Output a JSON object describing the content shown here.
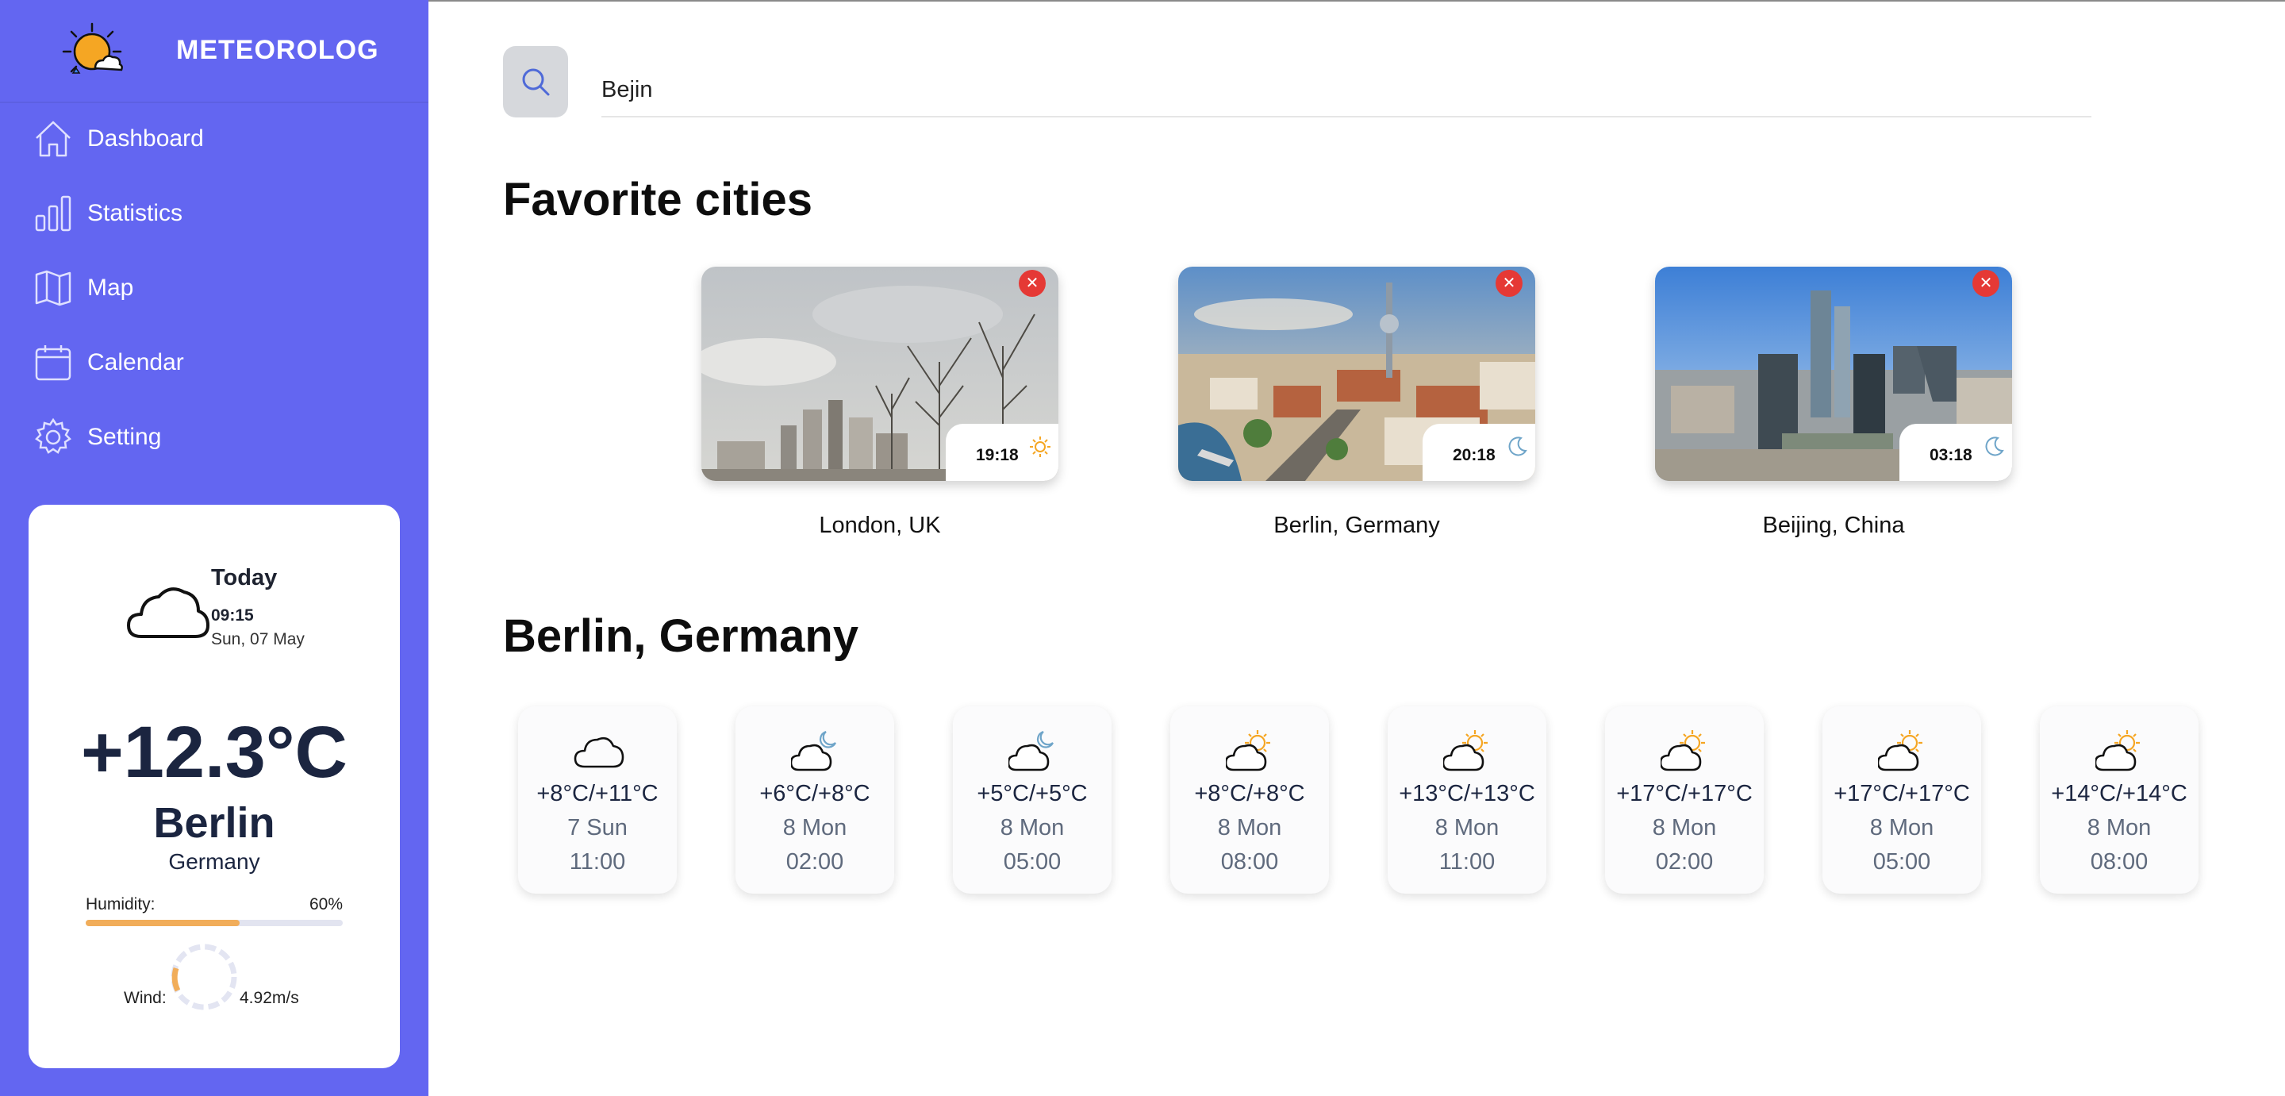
{
  "app": {
    "name": "METEOROLOG"
  },
  "nav": [
    {
      "label": "Dashboard",
      "icon": "home-icon"
    },
    {
      "label": "Statistics",
      "icon": "bar-chart-icon"
    },
    {
      "label": "Map",
      "icon": "map-icon"
    },
    {
      "label": "Calendar",
      "icon": "calendar-icon"
    },
    {
      "label": "Setting",
      "icon": "gear-icon"
    }
  ],
  "today": {
    "label": "Today",
    "time": "09:15",
    "date": "Sun, 07 May",
    "temperature": "+12.3°C",
    "city": "Berlin",
    "country": "Germany",
    "humidity_label": "Humidity:",
    "humidity_value": "60%",
    "humidity_fraction": 0.6,
    "wind_label": "Wind:",
    "wind_value": "4.92m/s"
  },
  "search": {
    "value": "Bejin",
    "icon": "search-icon"
  },
  "favorites": {
    "title": "Favorite cities",
    "cities": [
      {
        "name": "London, UK",
        "time": "19:18",
        "icon": "sun-icon"
      },
      {
        "name": "Berlin, Germany",
        "time": "20:18",
        "icon": "moon-icon"
      },
      {
        "name": "Beijing, China",
        "time": "03:18",
        "icon": "moon-icon"
      }
    ]
  },
  "forecast": {
    "title": "Berlin, Germany",
    "items": [
      {
        "temp": "+8°C/+11°C",
        "day": "7 Sun",
        "hour": "11:00",
        "icon": "cloud-icon"
      },
      {
        "temp": "+6°C/+8°C",
        "day": "8 Mon",
        "hour": "02:00",
        "icon": "cloud-moon-icon"
      },
      {
        "temp": "+5°C/+5°C",
        "day": "8 Mon",
        "hour": "05:00",
        "icon": "cloud-moon-icon"
      },
      {
        "temp": "+8°C/+8°C",
        "day": "8 Mon",
        "hour": "08:00",
        "icon": "sun-cloud-icon"
      },
      {
        "temp": "+13°C/+13°C",
        "day": "8 Mon",
        "hour": "11:00",
        "icon": "sun-cloud-icon"
      },
      {
        "temp": "+17°C/+17°C",
        "day": "8 Mon",
        "hour": "02:00",
        "icon": "sun-cloud-icon"
      },
      {
        "temp": "+17°C/+17°C",
        "day": "8 Mon",
        "hour": "05:00",
        "icon": "sun-cloud-icon"
      },
      {
        "temp": "+14°C/+14°C",
        "day": "8 Mon",
        "hour": "08:00",
        "icon": "sun-cloud-icon"
      }
    ]
  },
  "colors": {
    "sidebar": "#6366f1",
    "accent": "#f1ad5a",
    "danger": "#e53935"
  }
}
